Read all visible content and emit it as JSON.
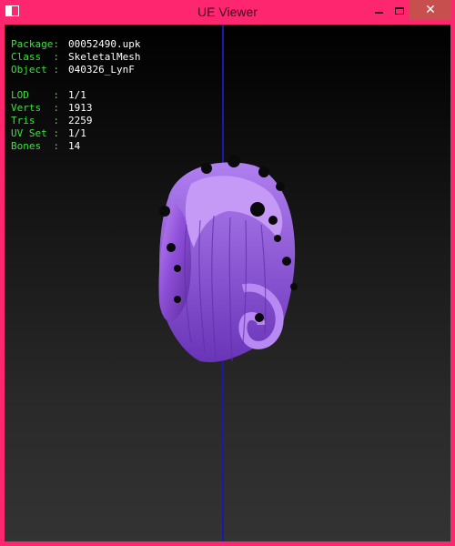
{
  "window": {
    "title": "UE Viewer",
    "close_glyph": "✕"
  },
  "info": {
    "package_label": "Package:",
    "package_value": "00052490.upk",
    "class_label": "Class  :",
    "class_value": "SkeletalMesh",
    "object_label": "Object :",
    "object_value": "040326_LynF",
    "lod_label": "LOD    :",
    "lod_value": "1/1",
    "verts_label": "Verts  :",
    "verts_value": "1913",
    "tris_label": "Tris   :",
    "tris_value": "2259",
    "uvset_label": "UV Set :",
    "uvset_value": "1/1",
    "bones_label": "Bones  :",
    "bones_value": "14"
  },
  "colors": {
    "frame": "#ff2670",
    "label": "#3de03d",
    "value": "#ffffff",
    "axis": "#1a1aa8",
    "hair": "#9a5ee0",
    "close_button": "#c7504f"
  },
  "icons": [
    "app-icon",
    "minimize-icon",
    "maximize-icon",
    "close-icon"
  ]
}
